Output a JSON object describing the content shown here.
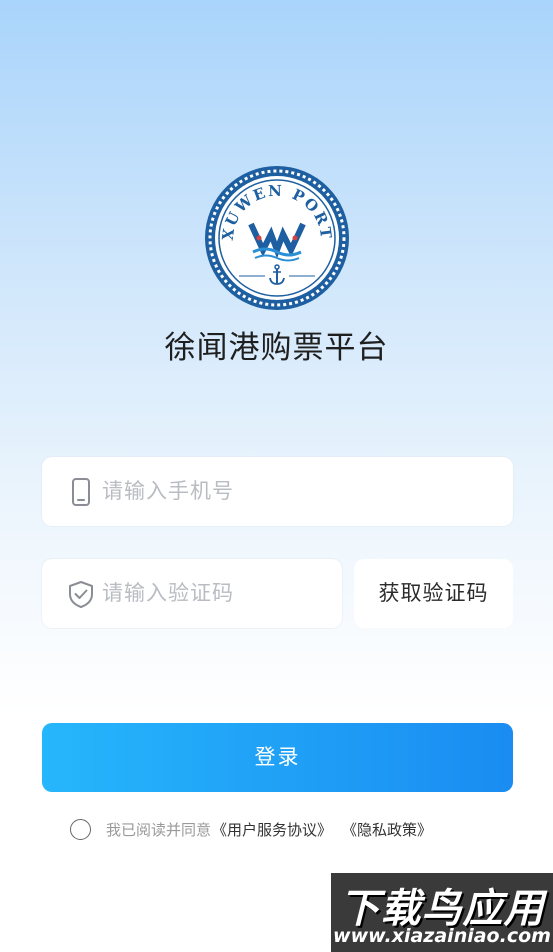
{
  "app": {
    "title": "徐闻港购票平台",
    "logo_text": "XUWEN PORT"
  },
  "form": {
    "phone_placeholder": "请输入手机号",
    "code_placeholder": "请输入验证码",
    "get_code_label": "获取验证码",
    "login_label": "登录"
  },
  "agreement": {
    "text": "我已阅读并同意",
    "service_link": "《用户服务协议》",
    "privacy_link": "《隐私政策》",
    "checked": false
  },
  "watermark": {
    "main": "下载鸟应用",
    "url": "www.xiazainiao.com"
  },
  "colors": {
    "accent_start": "#26b6fb",
    "accent_end": "#1a8cf2",
    "logo_blue": "#1d5fa0"
  },
  "icons": {
    "phone": "phone-icon",
    "shield": "shield-check-icon",
    "anchor": "anchor-icon"
  }
}
